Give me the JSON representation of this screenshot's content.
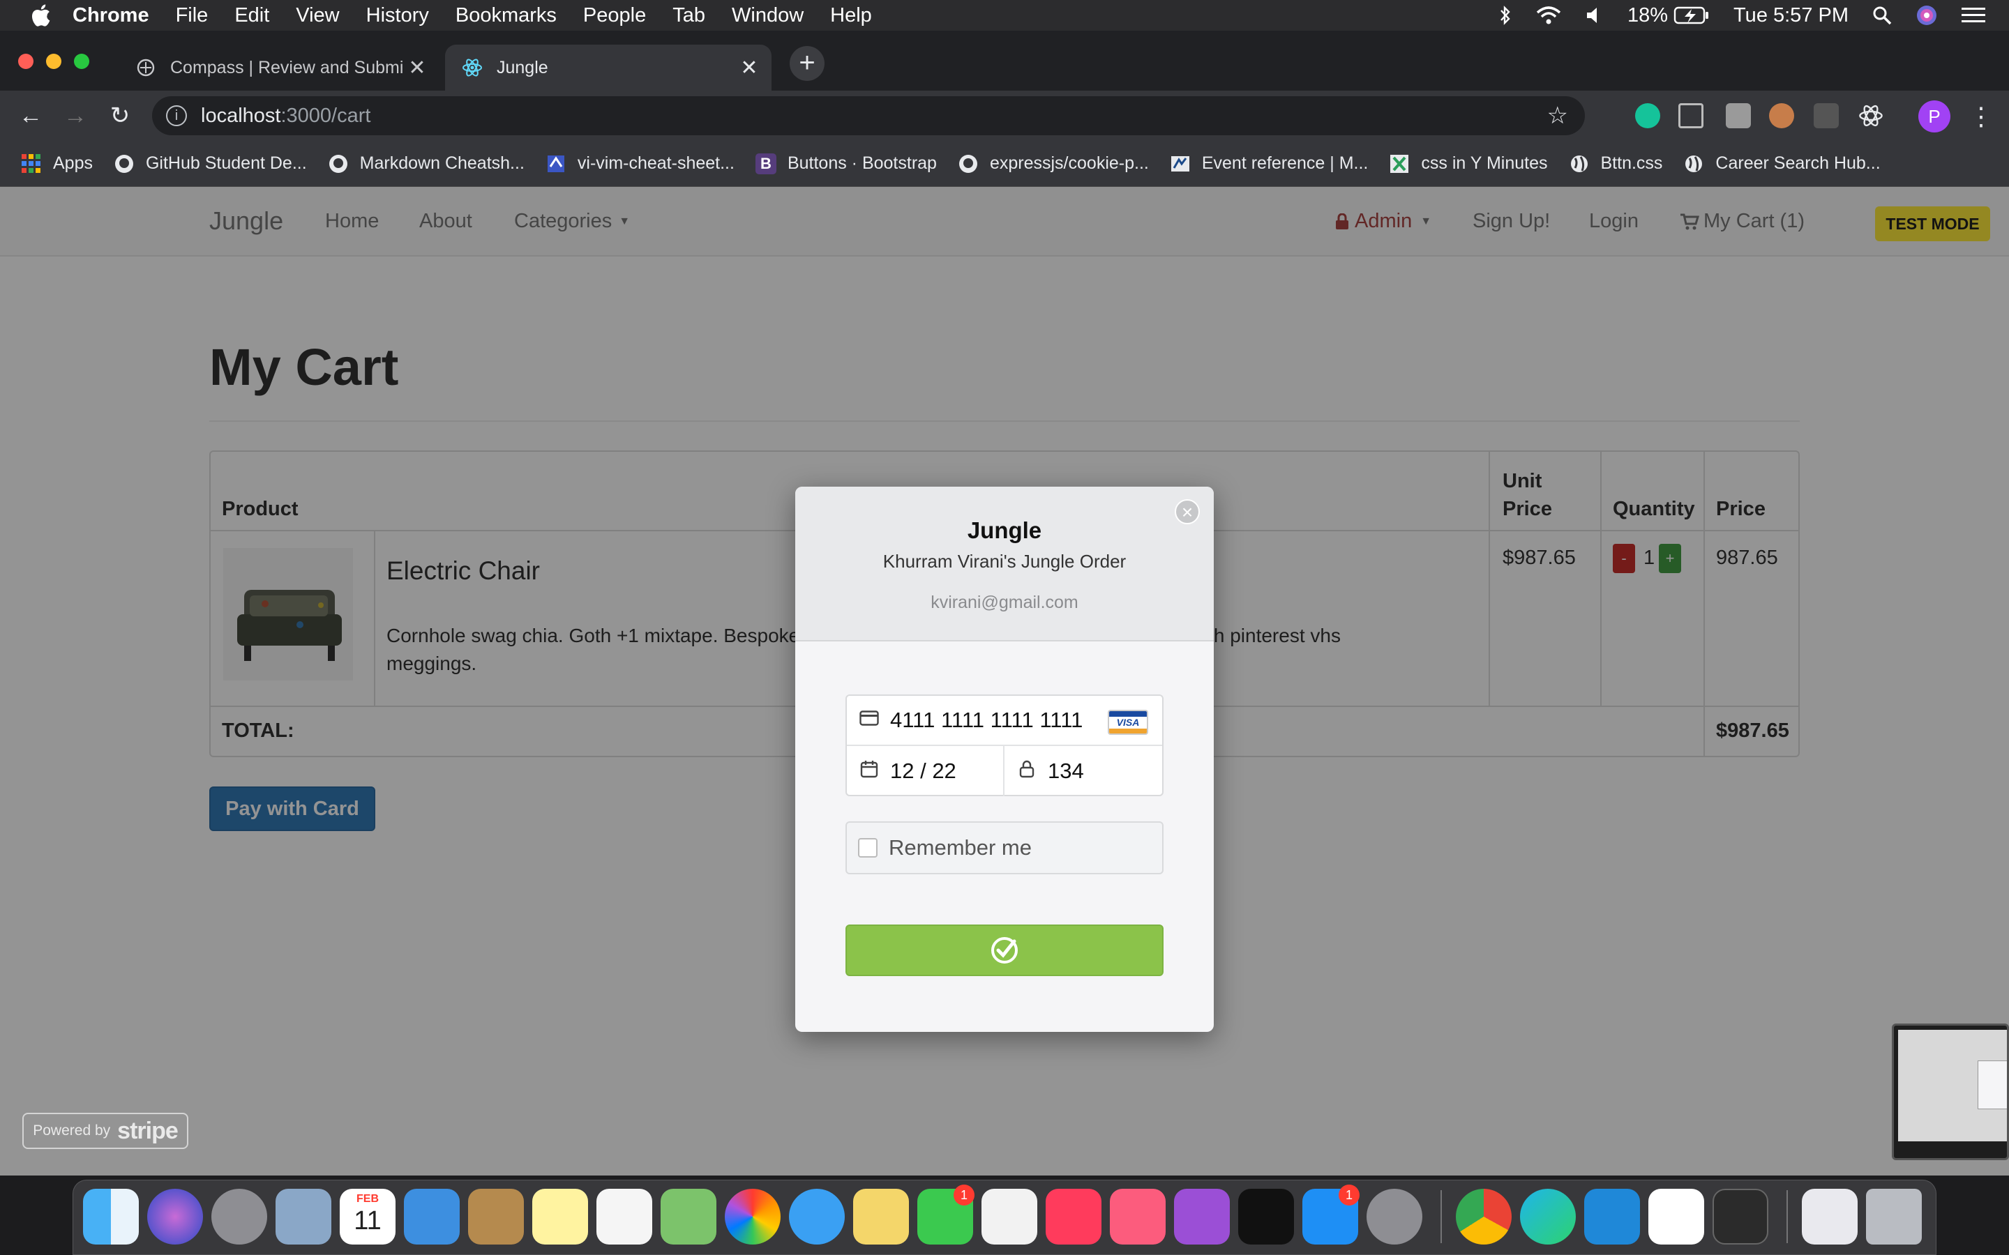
{
  "menubar": {
    "app_name": "Chrome",
    "items": [
      "File",
      "Edit",
      "View",
      "History",
      "Bookmarks",
      "People",
      "Tab",
      "Window",
      "Help"
    ],
    "battery": "18%",
    "clock": "Tue 5:57 PM"
  },
  "tabs": [
    {
      "title": "Compass | Review and Submit Ju",
      "active": false
    },
    {
      "title": "Jungle",
      "active": true
    }
  ],
  "omnibox": {
    "host": "localhost",
    "path": ":3000/cart"
  },
  "profile_initial": "P",
  "bookmarks": [
    {
      "label": "Apps",
      "icon": "apps-grid-icon"
    },
    {
      "label": "GitHub Student De...",
      "icon": "github-icon"
    },
    {
      "label": "Markdown Cheatsh...",
      "icon": "github-icon"
    },
    {
      "label": "vi-vim-cheat-sheet...",
      "icon": "vim-icon"
    },
    {
      "label": "Buttons · Bootstrap",
      "icon": "bootstrap-icon"
    },
    {
      "label": "expressjs/cookie-p...",
      "icon": "github-icon"
    },
    {
      "label": "Event reference | M...",
      "icon": "mdn-icon"
    },
    {
      "label": "css in Y Minutes",
      "icon": "learnx-icon"
    },
    {
      "label": "Bttn.css",
      "icon": "globe-icon"
    },
    {
      "label": "Career Search Hub...",
      "icon": "globe-icon"
    }
  ],
  "navbar": {
    "brand": "Jungle",
    "home": "Home",
    "about": "About",
    "categories": "Categories",
    "admin": "Admin",
    "signup": "Sign Up!",
    "login": "Login",
    "cart": "My Cart (1)",
    "test_mode": "TEST MODE"
  },
  "page": {
    "title": "My Cart",
    "pay_button": "Pay with Card"
  },
  "table": {
    "headers": {
      "product": "Product",
      "unit_price_1": "Unit",
      "unit_price_2": "Price",
      "quantity": "Quantity",
      "price": "Price"
    },
    "rows": [
      {
        "name": "Electric Chair",
        "description": "Cornhole swag chia. Goth +1 mixtape. Bespoke",
        "description_tail": "shoreditch pinterest vhs",
        "description_line2": "meggings.",
        "unit_price": "$987.65",
        "minus": "-",
        "quantity": "1",
        "plus": "+",
        "price": "987.65"
      }
    ],
    "total_label": "TOTAL:",
    "total_value": "$987.65"
  },
  "stripe_badge": {
    "powered_by": "Powered by",
    "brand": "stripe"
  },
  "modal": {
    "title": "Jungle",
    "subtitle": "Khurram Virani's Jungle Order",
    "email": "kvirani@gmail.com",
    "card_number": "4111 1111 1111 1111",
    "card_brand": "VISA",
    "expiry": "12 / 22",
    "cvc": "134",
    "remember_me": "Remember me",
    "close_glyph": "×"
  },
  "dock": {
    "calendar_month": "FEB",
    "calendar_day": "11",
    "badges": {
      "facetime": "1",
      "app_store": "1"
    }
  },
  "colors": {
    "submit_green": "#8bc34a",
    "pay_blue": "#337ab7",
    "test_mode_yellow": "#ffeb3b",
    "admin_red": "#a94442"
  }
}
